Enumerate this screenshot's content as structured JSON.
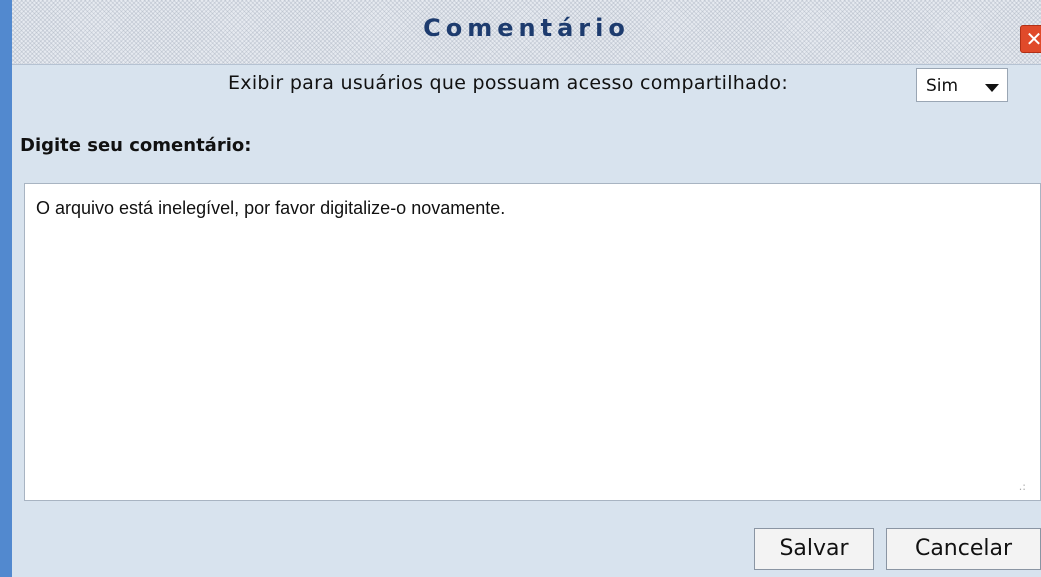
{
  "dialog": {
    "title": "Comentário",
    "close_icon": "close-icon",
    "share": {
      "label": "Exibir para usuários que possuam acesso compartilhado:",
      "selected": "Sim"
    },
    "comment": {
      "label": "Digite seu comentário:",
      "value": "O arquivo está inelegível, por favor digitalize-o novamente."
    },
    "buttons": {
      "save": "Salvar",
      "cancel": "Cancelar"
    }
  }
}
